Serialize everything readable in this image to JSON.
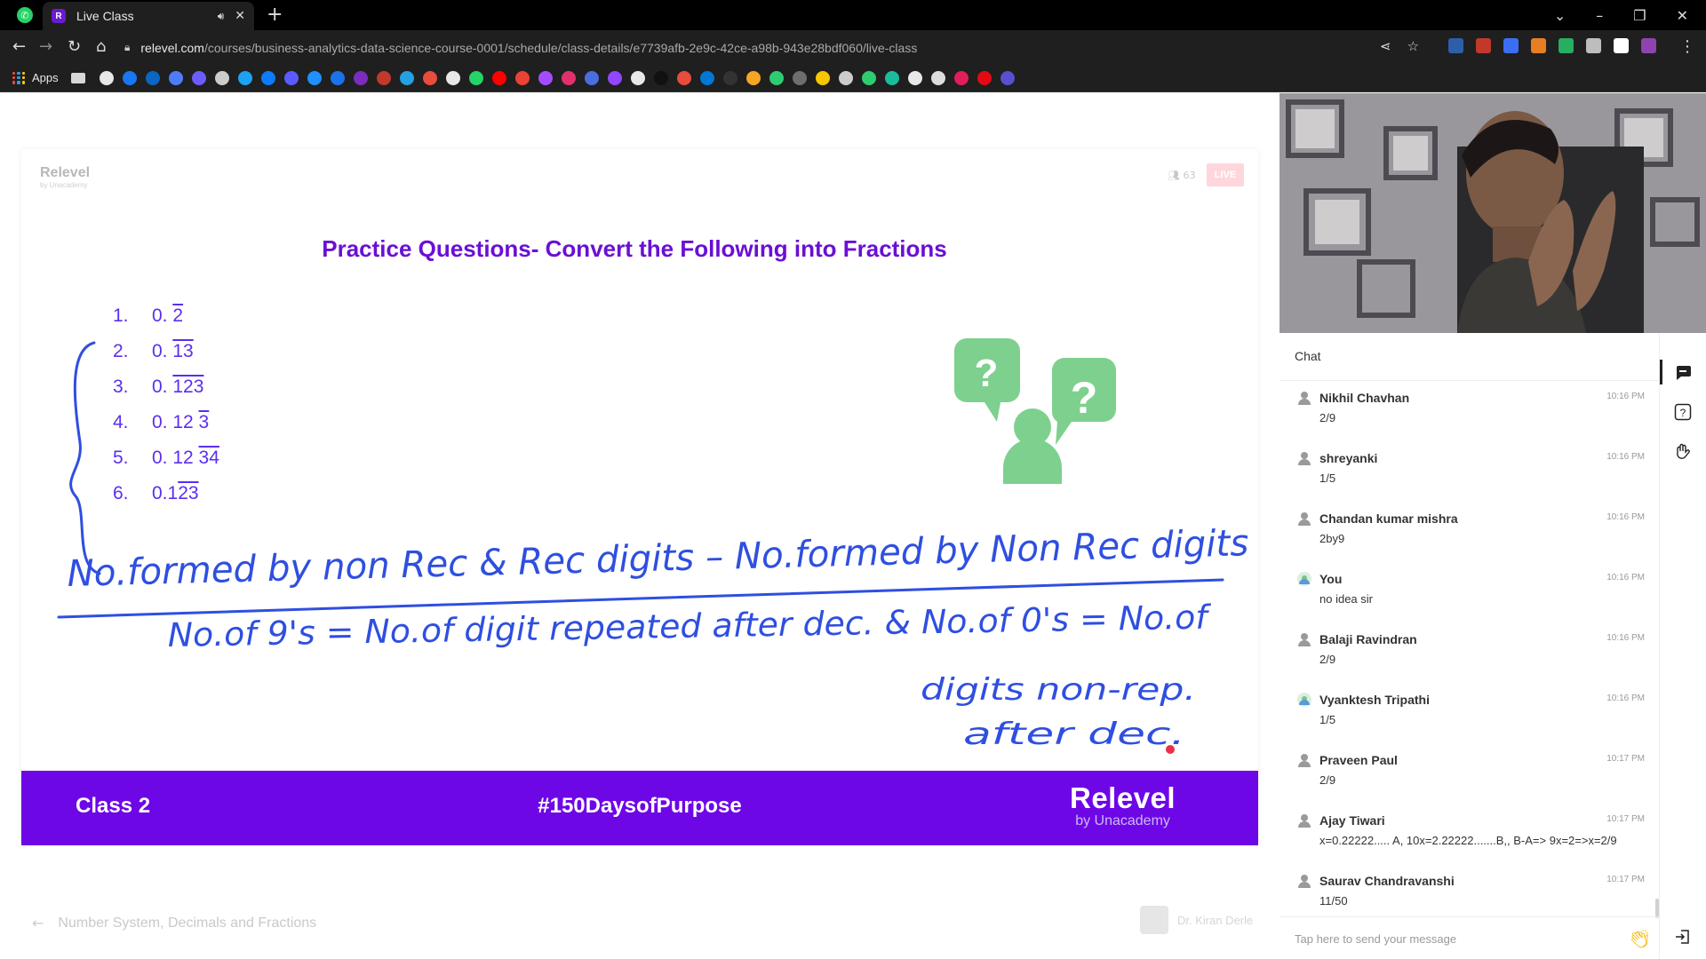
{
  "browser": {
    "tab_title": "Live Class",
    "tab_favicon_letter": "R",
    "url_domain": "relevel.com",
    "url_path": "/courses/business-analytics-data-science-course-0001/schedule/class-details/e7739afb-2e9c-42ce-a98b-943e28bdf060/live-class",
    "apps_label": "Apps",
    "bookmark_colors": [
      "#e8e8e8",
      "#1877f2",
      "#0a66c2",
      "#4f7df9",
      "#6b5cff",
      "#cccccc",
      "#1da1f2",
      "#0e7afe",
      "#5b5bff",
      "#1e90ff",
      "#1a73e8",
      "#7b2cbf",
      "#c0392b",
      "#25a0e0",
      "#e84c3d",
      "#e8e8e8",
      "#25d366",
      "#ff0000",
      "#ea4335",
      "#a34cff",
      "#e1306c",
      "#4a6ee0",
      "#9146ff",
      "#e8e8e8",
      "#111111",
      "#e74c3c",
      "#0078d4",
      "#333333",
      "#f5a623",
      "#2ecc71",
      "#6e6e6e",
      "#f7c600",
      "#cccccc",
      "#2ecc71",
      "#1abc9c",
      "#e8e8e8",
      "#dddddd",
      "#e01e5a",
      "#e50914",
      "#5a4fcf"
    ],
    "extension_colors": [
      "#2c5fa8",
      "#c0392b",
      "#3b6ef5",
      "#e67e22",
      "#27ae60",
      "#bdbdbd",
      "#ffffff",
      "#8e44ad"
    ]
  },
  "slide": {
    "brand": "Relevel",
    "brand_sub": "by Unacademy",
    "viewer_count": "63",
    "live_label": "LIVE",
    "heading": "Practice Questions- Convert the Following into Fractions",
    "questions": [
      {
        "num": "1.",
        "lead": "0. ",
        "rep": "2"
      },
      {
        "num": "2.",
        "lead": "0. ",
        "rep": "13"
      },
      {
        "num": "3.",
        "lead": "0. ",
        "rep": "123"
      },
      {
        "num": "4.",
        "lead": "0. 12 ",
        "rep": "3"
      },
      {
        "num": "5.",
        "lead": "0. 12 ",
        "rep": "34"
      },
      {
        "num": "6.",
        "lead": "0.1",
        "rep": "23"
      }
    ],
    "handwriting": {
      "numerator": "No.formed by non Rec & Rec digits – No.formed by Non Rec digits",
      "denominator": "No.of 9's = No.of digit repeated after dec. & No.of 0's = No.of",
      "line3": "digits non-rep.",
      "line4": "after dec."
    },
    "banner_left": "Class 2",
    "banner_mid": "#150DaysofPurpose",
    "banner_brand": "Relevel",
    "banner_brand_sub": "by Unacademy",
    "accent_color": "#6e07e6",
    "ink_color": "#2f4fe0"
  },
  "footer": {
    "lesson_title": "Number System, Decimals and Fractions",
    "teacher_name": "Dr. Kiran Derle"
  },
  "chat": {
    "title": "Chat",
    "input_placeholder": "Tap here to send your message",
    "messages": [
      {
        "name": "Nikhil Chavhan",
        "time": "10:16 PM",
        "text": "2/9",
        "avatar": "person"
      },
      {
        "name": "shreyanki",
        "time": "10:16 PM",
        "text": "1/5",
        "avatar": "person"
      },
      {
        "name": "Chandan kumar mishra",
        "time": "10:16 PM",
        "text": "2by9",
        "avatar": "person"
      },
      {
        "name": "You",
        "time": "10:16 PM",
        "text": "no idea sir",
        "avatar": "photo"
      },
      {
        "name": "Balaji Ravindran",
        "time": "10:16 PM",
        "text": "2/9",
        "avatar": "person"
      },
      {
        "name": "Vyanktesh Tripathi",
        "time": "10:16 PM",
        "text": "1/5",
        "avatar": "photo"
      },
      {
        "name": "Praveen Paul",
        "time": "10:17 PM",
        "text": "2/9",
        "avatar": "person"
      },
      {
        "name": "Ajay Tiwari",
        "time": "10:17 PM",
        "text": "x=0.22222..... A, 10x=2.22222.......B,, B-A=> 9x=2=>x=2/9",
        "avatar": "person"
      },
      {
        "name": "Saurav Chandravanshi",
        "time": "10:17 PM",
        "text": "11/50",
        "avatar": "person"
      }
    ]
  },
  "side_rail": [
    "chat-icon",
    "question-icon",
    "raise-hand-icon",
    "exit-icon"
  ]
}
